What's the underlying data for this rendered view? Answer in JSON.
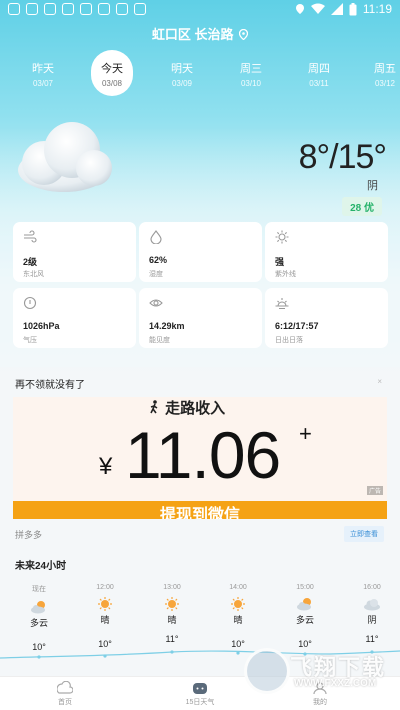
{
  "status_bar": {
    "time": "11:19"
  },
  "location": "虹口区 长治路",
  "days": [
    {
      "name": "昨天",
      "date": "03/07",
      "active": false
    },
    {
      "name": "今天",
      "date": "03/08",
      "active": true
    },
    {
      "name": "明天",
      "date": "03/09",
      "active": false
    },
    {
      "name": "周三",
      "date": "03/10",
      "active": false
    },
    {
      "name": "周四",
      "date": "03/11",
      "active": false
    },
    {
      "name": "周五",
      "date": "03/12",
      "active": false
    }
  ],
  "current": {
    "temperature": "8°/15°",
    "condition": "阴",
    "aqi": "28 优"
  },
  "details": [
    {
      "icon": "wind-icon",
      "value": "2级",
      "label": "东北风"
    },
    {
      "icon": "humidity-icon",
      "value": "62%",
      "label": "湿度"
    },
    {
      "icon": "uv-icon",
      "value": "强",
      "label": "紫外线"
    },
    {
      "icon": "pressure-icon",
      "value": "1026hPa",
      "label": "气压"
    },
    {
      "icon": "visibility-icon",
      "value": "14.29km",
      "label": "能见度"
    },
    {
      "icon": "sunrise-icon",
      "value": "6:12/17:57",
      "label": "日出日落"
    }
  ],
  "ad": {
    "title": "再不领就没有了",
    "close": "×",
    "walk_text": "走路收入",
    "currency": "¥",
    "amount": "11.06",
    "plus": "+",
    "bar_text": "提现到微信",
    "tag": "广告",
    "source": "拼多多",
    "button": "立即查看"
  },
  "hourly": {
    "title": "未来24小时",
    "items": [
      {
        "time": "现在",
        "icon": "partly-cloudy-icon",
        "condition": "多云",
        "temp": "10°"
      },
      {
        "time": "12:00",
        "icon": "sun-icon",
        "condition": "晴",
        "temp": "10°"
      },
      {
        "time": "13:00",
        "icon": "sun-icon",
        "condition": "晴",
        "temp": "11°"
      },
      {
        "time": "14:00",
        "icon": "sun-icon",
        "condition": "晴",
        "temp": "10°"
      },
      {
        "time": "15:00",
        "icon": "partly-cloudy-icon",
        "condition": "多云",
        "temp": "10°"
      },
      {
        "time": "16:00",
        "icon": "cloud-icon",
        "condition": "阴",
        "temp": "11°"
      }
    ]
  },
  "tabs": [
    {
      "label": "首页",
      "icon": "home-icon"
    },
    {
      "label": "15日天气",
      "icon": "calendar-icon"
    },
    {
      "label": "我的",
      "icon": "profile-icon"
    }
  ],
  "watermark": {
    "big": "飞翔下载",
    "small": "WWW.FXXZ.COM"
  },
  "colors": {
    "sky": "#5fd0e6",
    "aqi_green": "#26b26a",
    "ad_orange": "#f5a214",
    "sun": "#f7a53b"
  }
}
